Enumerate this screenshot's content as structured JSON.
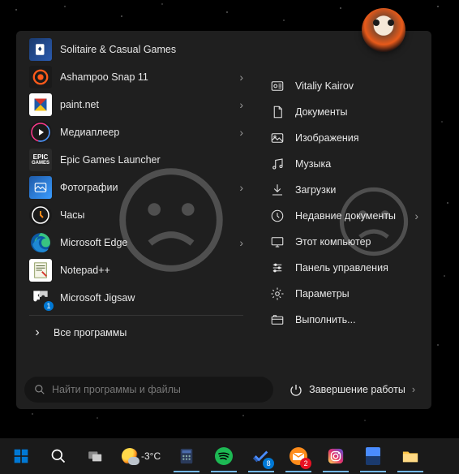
{
  "user": {
    "name": "Vitaliy Kairov"
  },
  "left_apps": [
    {
      "id": "solitaire",
      "label": "Solitaire & Casual Games",
      "icon": "solitaire",
      "chev": false
    },
    {
      "id": "ashampoo",
      "label": "Ashampoo Snap 11",
      "icon": "ashampoo",
      "chev": true
    },
    {
      "id": "paintnet",
      "label": "paint.net",
      "icon": "paintnet",
      "chev": true
    },
    {
      "id": "mediaplayer",
      "label": "Медиаплеер",
      "icon": "mediaplayer",
      "chev": true
    },
    {
      "id": "epic",
      "label": "Epic Games Launcher",
      "icon": "epic",
      "chev": false
    },
    {
      "id": "photos",
      "label": "Фотографии",
      "icon": "photos",
      "chev": true
    },
    {
      "id": "clock",
      "label": "Часы",
      "icon": "clock",
      "chev": false
    },
    {
      "id": "edge",
      "label": "Microsoft Edge",
      "icon": "edge",
      "chev": true
    },
    {
      "id": "notepadpp",
      "label": "Notepad++",
      "icon": "notepadpp",
      "chev": false
    },
    {
      "id": "jigsaw",
      "label": "Microsoft Jigsaw",
      "icon": "jigsaw",
      "chev": false
    }
  ],
  "all_programs": {
    "label": "Все программы"
  },
  "right_items": [
    {
      "id": "user",
      "label": "Vitaliy Kairov",
      "icon": "user",
      "chev": false
    },
    {
      "id": "documents",
      "label": "Документы",
      "icon": "documents",
      "chev": false
    },
    {
      "id": "pictures",
      "label": "Изображения",
      "icon": "pictures",
      "chev": false
    },
    {
      "id": "music",
      "label": "Музыка",
      "icon": "music",
      "chev": false
    },
    {
      "id": "downloads",
      "label": "Загрузки",
      "icon": "downloads",
      "chev": false
    },
    {
      "id": "recent",
      "label": "Недавние документы",
      "icon": "recent",
      "chev": true
    },
    {
      "id": "thispc",
      "label": "Этот компьютер",
      "icon": "thispc",
      "chev": false
    },
    {
      "id": "control",
      "label": "Панель управления",
      "icon": "control",
      "chev": false
    },
    {
      "id": "settings",
      "label": "Параметры",
      "icon": "settings",
      "chev": false
    },
    {
      "id": "run",
      "label": "Выполнить...",
      "icon": "run",
      "chev": false
    }
  ],
  "search": {
    "placeholder": "Найти программы и файлы"
  },
  "shutdown": {
    "label": "Завершение работы"
  },
  "weather": {
    "temp": "-3°C"
  },
  "taskbar_badges": {
    "todo": "8",
    "mail": "2"
  }
}
